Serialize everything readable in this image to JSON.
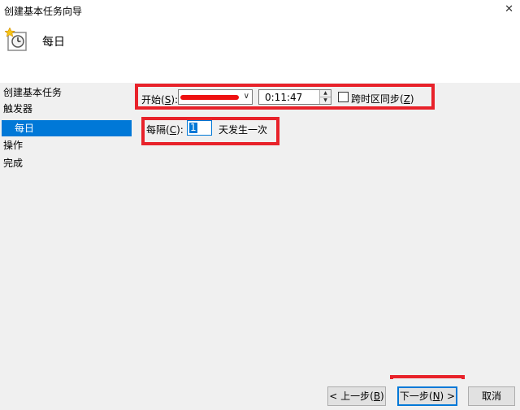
{
  "window": {
    "title": "创建基本任务向导",
    "close": "✕"
  },
  "header": {
    "title": "每日",
    "icon": "clock-wizard-icon"
  },
  "nav": {
    "items": [
      {
        "label": "创建基本任务"
      },
      {
        "label": "触发器"
      },
      {
        "label": "每日"
      },
      {
        "label": "操作"
      },
      {
        "label": "完成"
      }
    ],
    "selected_index": 2
  },
  "start": {
    "label": "开始(",
    "accel": "S",
    "label_end": "):",
    "date": "",
    "time": "0:11:47"
  },
  "sync": {
    "label": "跨时区同步(",
    "accel": "Z",
    "label_end": ")",
    "checked": false
  },
  "recur": {
    "label": "每隔(",
    "accel": "C",
    "label_end": "):",
    "value": "1",
    "suffix": "天发生一次"
  },
  "buttons": {
    "back": {
      "prefix": "< 上一步(",
      "accel": "B",
      "suffix": ")"
    },
    "next": {
      "prefix": "下一步(",
      "accel": "N",
      "suffix": ") >"
    },
    "cancel": "取消"
  },
  "colors": {
    "accent": "#0078d7",
    "highlight": "#e8222a",
    "background": "#f0f0f0"
  }
}
